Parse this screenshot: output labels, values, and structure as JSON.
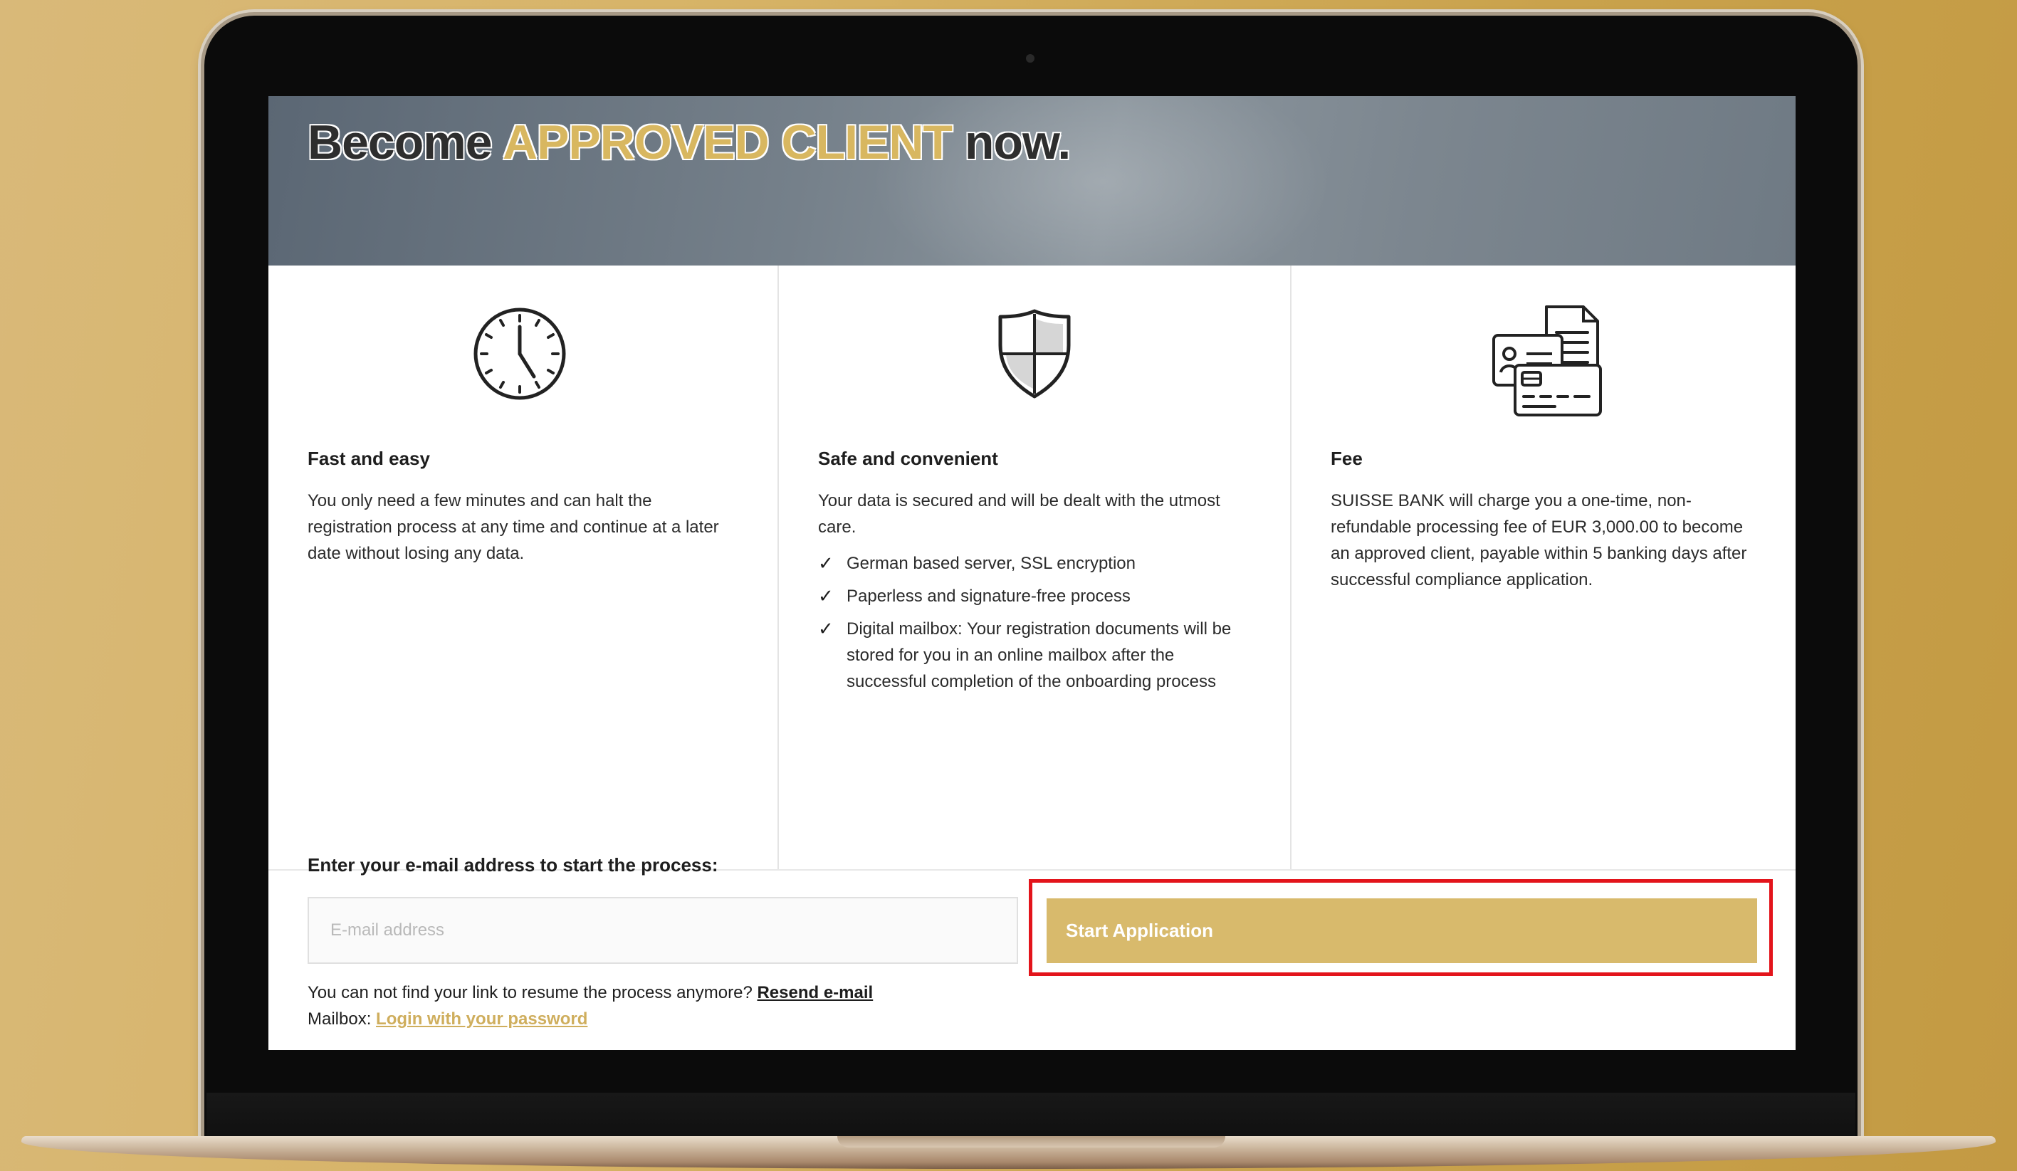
{
  "hero": {
    "title_prefix": "Become",
    "title_accent": "APPROVED CLIENT",
    "title_suffix": "now."
  },
  "features": [
    {
      "icon": "clock-icon",
      "title": "Fast and easy",
      "text": "You only need a few minutes and can halt the registration process at any time and continue at a later date without losing any data."
    },
    {
      "icon": "shield-icon",
      "title": "Safe and convenient",
      "text": "Your data is secured and will be dealt with the utmost care.",
      "checklist": [
        "German based server, SSL encryption",
        "Paperless and signature-free process",
        "Digital mailbox: Your registration documents will be stored for you in an online mailbox after the successful completion of the onboarding process"
      ],
      "check_glyph": "✓"
    },
    {
      "icon": "documents-card-icon",
      "title": "Fee",
      "text": "SUISSE BANK will charge you a one-time, non-refundable processing fee of EUR 3,000.00 to become an approved client, payable within 5 banking days after successful compliance application."
    }
  ],
  "form": {
    "label": "Enter your e-mail address to start the process:",
    "email_placeholder": "E-mail address",
    "email_value": "",
    "start_button": "Start Application",
    "resend_text": "You can not find your link to resume the process anymore?",
    "resend_link": "Resend e-mail",
    "mailbox_label": "Mailbox:",
    "mailbox_link": "Login with your password"
  },
  "colors": {
    "accent_gold": "#d8ba6c",
    "highlight_red": "#e3141b",
    "hero_gray": "#7c868f"
  }
}
